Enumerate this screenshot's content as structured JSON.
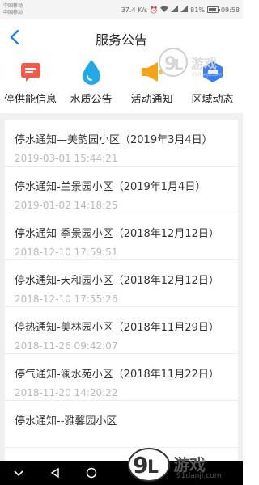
{
  "status_bar": {
    "carrier_1": "中国移动",
    "carrier_2": "中国移动",
    "speed": "37.4 K/s",
    "battery": "81%",
    "time": "09:58"
  },
  "header": {
    "title": "服务公告"
  },
  "categories": [
    {
      "label": "停供能信息",
      "icon": "message-icon",
      "color": "#f05a4a"
    },
    {
      "label": "水质公告",
      "icon": "water-drop-icon",
      "color": "#23a8e6"
    },
    {
      "label": "活动通知",
      "icon": "megaphone-icon",
      "color": "#f5a31a"
    },
    {
      "label": "区域动态",
      "icon": "area-icon",
      "color": "#3b7ff0"
    }
  ],
  "notices": [
    {
      "title": "停水通知—美韵园小区（2019年3月4日）",
      "date": "2019-03-01 15:44:21"
    },
    {
      "title": "停水通知-兰景园小区（2019年1月4日）",
      "date": "2019-01-02 14:18:25"
    },
    {
      "title": "停水通知-季景园小区（2018年12月12日）",
      "date": "2018-12-10 17:59:51"
    },
    {
      "title": "停水通知-天和园小区（2018年12月12日）",
      "date": "2018-12-10 17:55:26"
    },
    {
      "title": "停热通知-美林园小区（2018年11月29日）",
      "date": "2018-11-26 09:42:07"
    },
    {
      "title": "停气通知-澜水苑小区（2018年11月22日）",
      "date": "2018-11-20 14:20:22"
    },
    {
      "title": "停水通知--雅馨园小区",
      "date": ""
    }
  ],
  "watermark": {
    "text": "游戏",
    "sub": "91danji.com",
    "small_sub": "91danji.com"
  },
  "colors": {
    "accent": "#1e88e5",
    "band": "#f0f0f0"
  }
}
